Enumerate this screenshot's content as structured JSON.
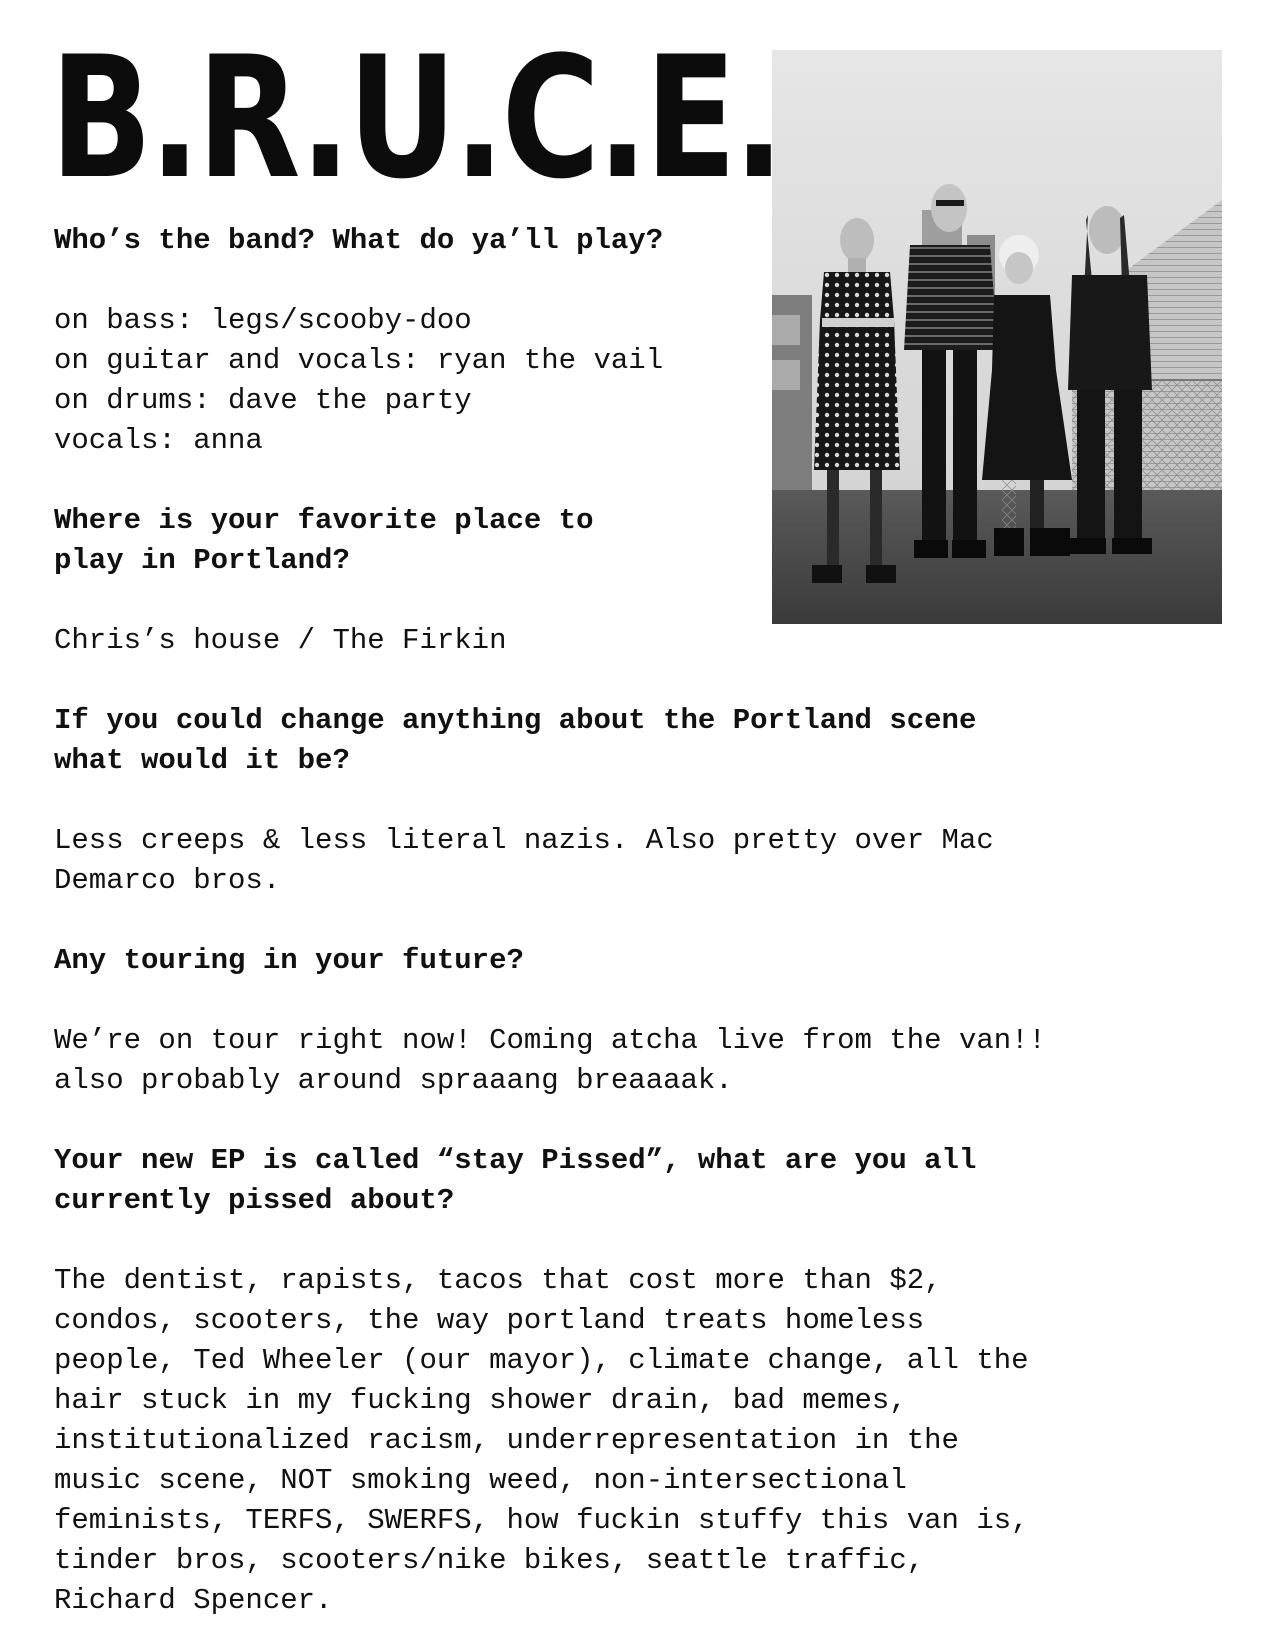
{
  "title": "B.R.U.C.E.",
  "sections": [
    {
      "question": [
        "Who’s the band? What do ya’ll play?"
      ],
      "answer": [
        "on bass: legs/scooby-doo",
        "on guitar and vocals: ryan the vail",
        "on drums: dave the party",
        "vocals: anna"
      ]
    },
    {
      "question": [
        "Where is your favorite place to",
        "play in Portland?"
      ],
      "answer": [
        "Chris’s house / The Firkin"
      ]
    },
    {
      "question": [
        "If you could change anything about the Portland scene",
        "what would it be?"
      ],
      "answer": [
        "Less creeps & less literal nazis. Also pretty over Mac",
        "Demarco bros."
      ]
    },
    {
      "question": [
        "Any touring in your future?"
      ],
      "answer": [
        "We’re on tour right now! Coming atcha live from the van!!",
        "also probably around spraaang breaaaak."
      ]
    },
    {
      "question": [
        "Your new EP is called “stay Pissed”, what are you all",
        "currently pissed about?"
      ],
      "answer": [
        "The dentist, rapists, tacos that cost more than $2,",
        "condos, scooters, the way portland treats homeless",
        "people, Ted Wheeler (our mayor), climate change, all the",
        "hair stuck in my fucking shower drain, bad memes,",
        "institutionalized racism, underrepresentation in the",
        "music scene, NOT smoking weed, non-intersectional",
        "feminists, TERFS, SWERFS, how fuckin stuffy this van is,",
        "tinder bros, scooters/nike bikes, seattle traffic,",
        "Richard Spencer."
      ]
    }
  ]
}
